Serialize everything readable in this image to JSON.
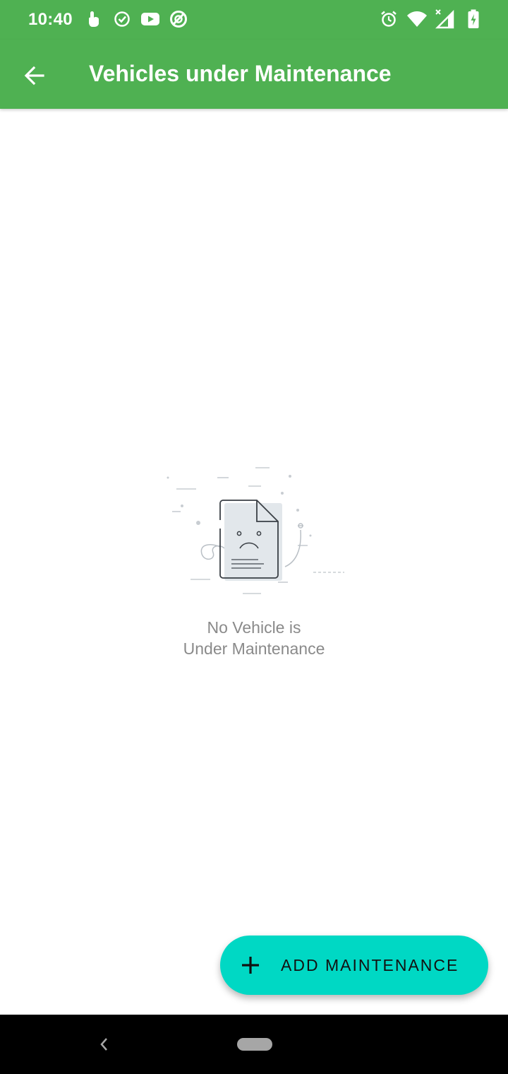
{
  "status_bar": {
    "time": "10:40",
    "left_icons": [
      "touch-icon",
      "check-circle-icon",
      "youtube-icon",
      "sync-icon"
    ],
    "right_icons": [
      "alarm-icon",
      "wifi-icon",
      "signal-icon",
      "battery-charging-icon"
    ]
  },
  "app_bar": {
    "title": "Vehicles under Maintenance",
    "back_icon": "arrow-back-icon"
  },
  "empty_state": {
    "line1": "No Vehicle is",
    "line2": "Under Maintenance",
    "illustration": "sad-document-icon"
  },
  "fab": {
    "label": "ADD MAINTENANCE",
    "icon": "plus-icon"
  },
  "colors": {
    "primary": "#4fb152",
    "accent": "#00d8c4",
    "empty_text": "#8a8a8a"
  }
}
